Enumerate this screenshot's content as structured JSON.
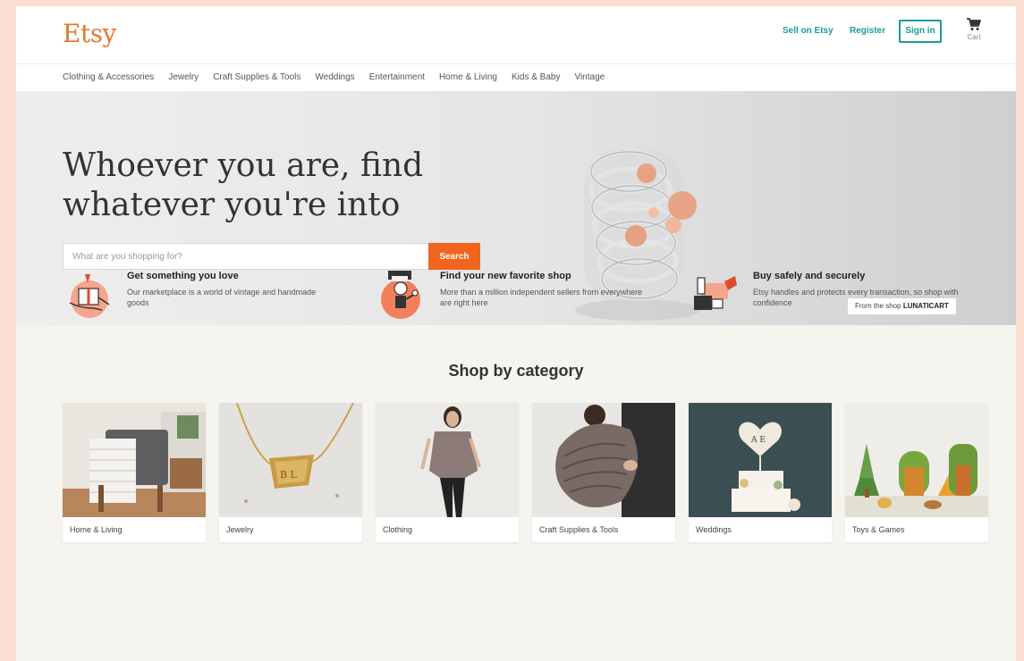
{
  "header": {
    "logo": "Etsy",
    "sell_link": "Sell on Etsy",
    "register_link": "Register",
    "sign_in_button": "Sign in",
    "cart_label": "Cart"
  },
  "nav": {
    "categories": [
      "Clothing & Accessories",
      "Jewelry",
      "Craft Supplies & Tools",
      "Weddings",
      "Entertainment",
      "Home & Living",
      "Kids & Baby",
      "Vintage"
    ]
  },
  "hero": {
    "title_line1": "Whoever you are, find",
    "title_line2": "whatever you're into",
    "search_placeholder": "What are you shopping for?",
    "search_button": "Search",
    "shop_credit_prefix": "From the shop",
    "shop_credit_name": "LUNATICART"
  },
  "value_props": [
    {
      "title": "Get something you love",
      "text": "Our marketplace is a world of vintage and handmade goods",
      "icon": "gift-hand-icon"
    },
    {
      "title": "Find your new favorite shop",
      "text": "More than a million independent sellers from everywhere are right here",
      "icon": "shop-person-icon"
    },
    {
      "title": "Buy safely and securely",
      "text": "Etsy handles and protects every transaction, so shop with confidence",
      "icon": "secure-payment-icon"
    }
  ],
  "category_section": {
    "heading": "Shop by category",
    "items": [
      "Home & Living",
      "Jewelry",
      "Clothing",
      "Craft Supplies & Tools",
      "Weddings",
      "Toys & Games"
    ]
  },
  "colors": {
    "brand": "#e6772e",
    "search_button": "#f1641e",
    "link_teal": "#1a9a9a",
    "outer_background": "#fcddd1"
  }
}
